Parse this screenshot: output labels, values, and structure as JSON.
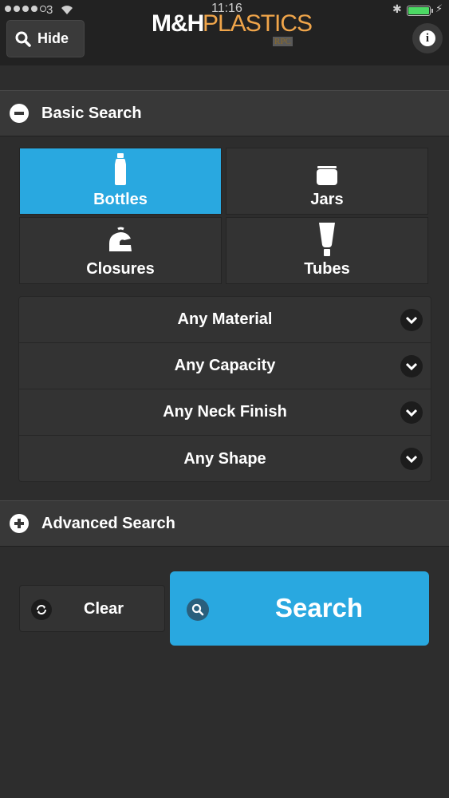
{
  "status_bar": {
    "carrier": "3",
    "time": "11:16"
  },
  "header": {
    "hide_label": "Hide",
    "logo_mh": "M&H",
    "logo_plastics": "PLASTICS",
    "logo_rpc": "RPC"
  },
  "basic_search": {
    "title": "Basic Search",
    "categories": [
      {
        "label": "Bottles",
        "icon": "bottle-icon",
        "selected": true
      },
      {
        "label": "Jars",
        "icon": "jar-icon",
        "selected": false
      },
      {
        "label": "Closures",
        "icon": "closure-icon",
        "selected": false
      },
      {
        "label": "Tubes",
        "icon": "tube-icon",
        "selected": false
      }
    ],
    "filters": [
      {
        "label": "Any Material"
      },
      {
        "label": "Any Capacity"
      },
      {
        "label": "Any Neck Finish"
      },
      {
        "label": "Any Shape"
      }
    ]
  },
  "advanced_search": {
    "title": "Advanced Search"
  },
  "actions": {
    "clear_label": "Clear",
    "search_label": "Search"
  },
  "colors": {
    "accent": "#29a8e0",
    "background": "#2d2d2d",
    "logo_orange": "#f0a54a"
  }
}
